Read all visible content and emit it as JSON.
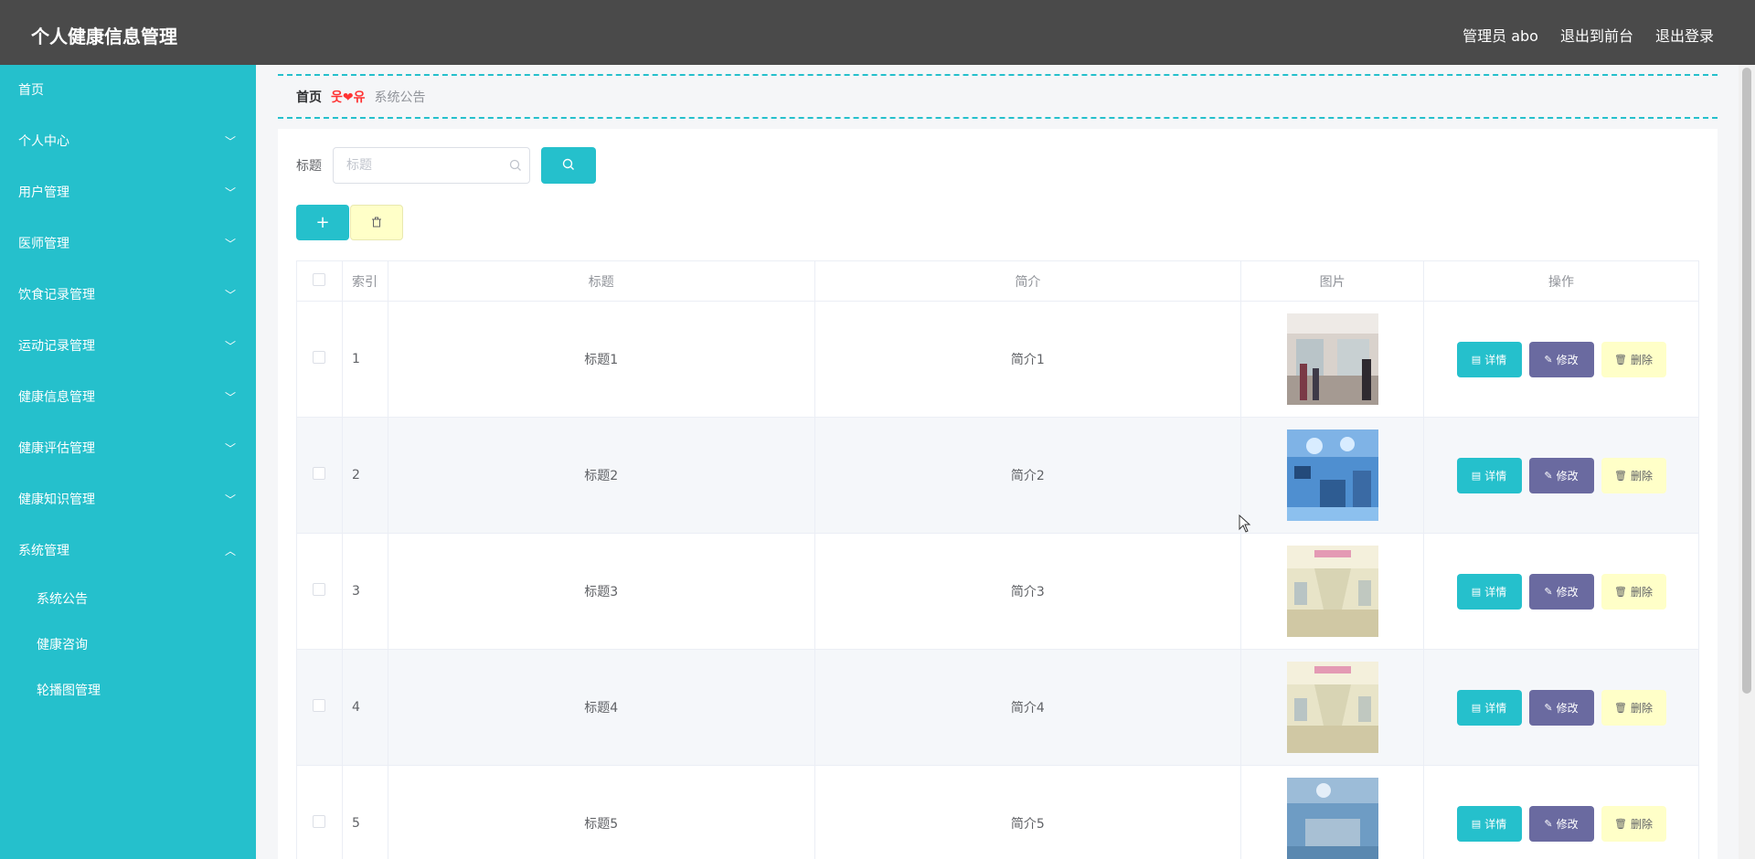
{
  "app": {
    "title": "个人健康信息管理"
  },
  "header": {
    "admin_label": "管理员 abo",
    "to_front": "退出到前台",
    "logout": "退出登录"
  },
  "sidebar": {
    "items": [
      {
        "label": "首页",
        "expandable": false
      },
      {
        "label": "个人中心",
        "expandable": true
      },
      {
        "label": "用户管理",
        "expandable": true
      },
      {
        "label": "医师管理",
        "expandable": true
      },
      {
        "label": "饮食记录管理",
        "expandable": true
      },
      {
        "label": "运动记录管理",
        "expandable": true
      },
      {
        "label": "健康信息管理",
        "expandable": true
      },
      {
        "label": "健康评估管理",
        "expandable": true
      },
      {
        "label": "健康知识管理",
        "expandable": true
      },
      {
        "label": "系统管理",
        "expandable": true,
        "expanded": true
      }
    ],
    "submenu": [
      "系统公告",
      "健康咨询",
      "轮播图管理"
    ]
  },
  "breadcrumb": {
    "home": "首页",
    "separator": "웃❤유",
    "current": "系统公告"
  },
  "search": {
    "label": "标题",
    "placeholder": "标题"
  },
  "table": {
    "headers": {
      "index": "索引",
      "title": "标题",
      "brief": "简介",
      "image": "图片",
      "ops": "操作"
    },
    "rows": [
      {
        "index": "1",
        "title": "标题1",
        "brief": "简介1",
        "image": "hospital-lobby"
      },
      {
        "index": "2",
        "title": "标题2",
        "brief": "简介2",
        "image": "operating-room"
      },
      {
        "index": "3",
        "title": "标题3",
        "brief": "简介3",
        "image": "hospital-corridor"
      },
      {
        "index": "4",
        "title": "标题4",
        "brief": "简介4",
        "image": "hospital-corridor"
      },
      {
        "index": "5",
        "title": "标题5",
        "brief": "简介5",
        "image": "operating-room-blue"
      }
    ],
    "actions": {
      "detail": "详情",
      "edit": "修改",
      "delete": "删除"
    }
  },
  "colors": {
    "accent": "#25c0cc",
    "header_bg": "#4a4a4a",
    "edit": "#6a6aa0",
    "delete": "#ffffc8"
  }
}
